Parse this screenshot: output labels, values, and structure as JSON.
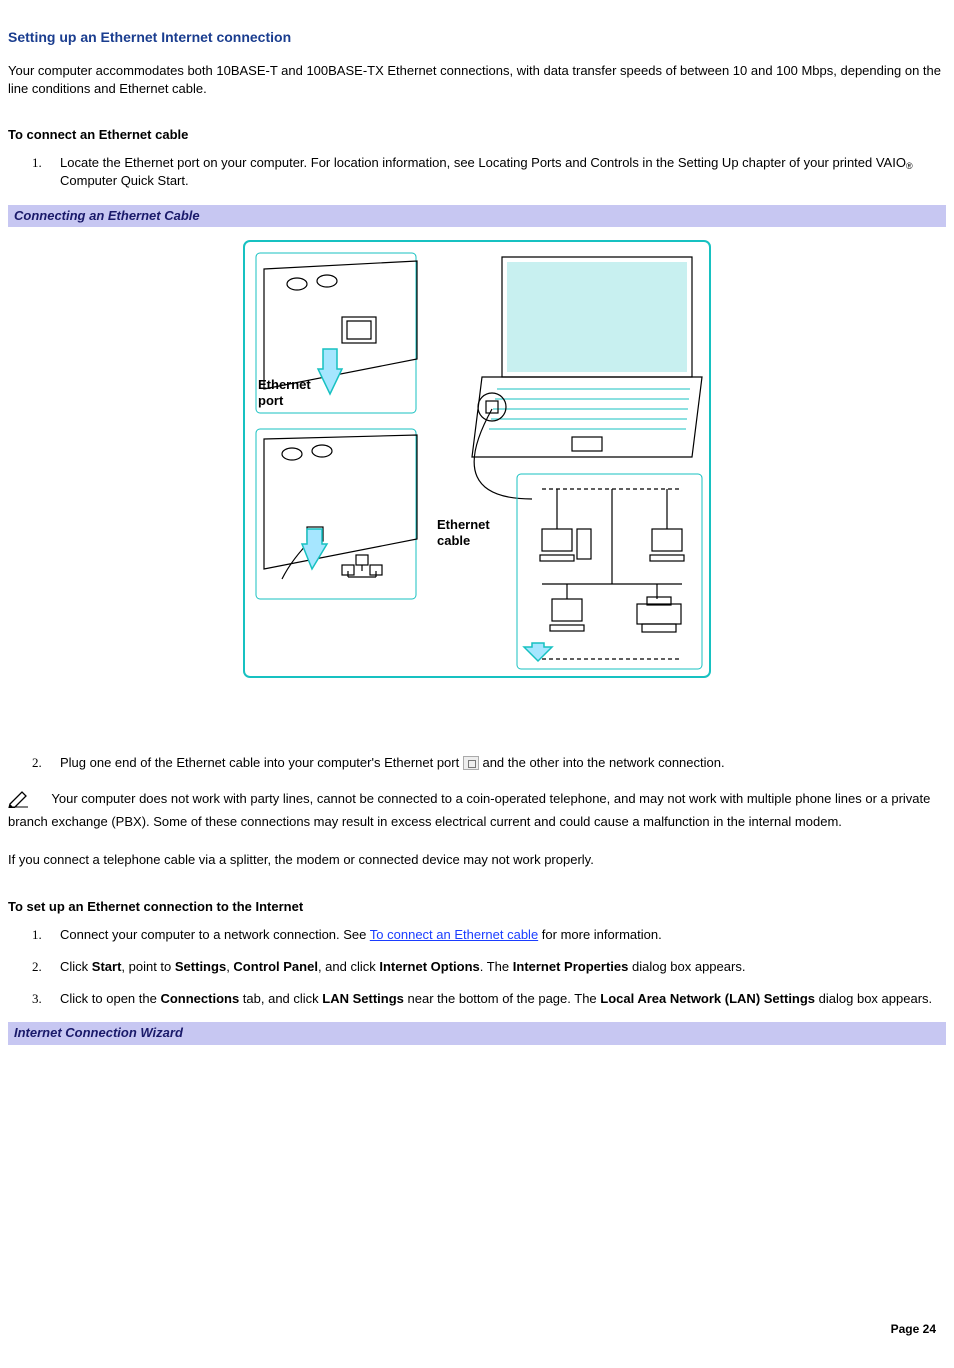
{
  "heading": "Setting up an Ethernet Internet connection",
  "intro": "Your computer accommodates both 10BASE-T and 100BASE-TX Ethernet connections, with data transfer speeds of between 10 and 100 Mbps, depending on the line conditions and Ethernet cable.",
  "sub1": "To connect an Ethernet cable",
  "step1a": "Locate the Ethernet port on your computer. For location information, see Locating Ports and Controls in the Setting Up chapter of your printed VAIO",
  "step1b": " Computer Quick Start.",
  "reg": "®",
  "caption1": "Connecting an Ethernet Cable",
  "fig_label_port": "Ethernet",
  "fig_label_port2": "port",
  "fig_label_cable": "Ethernet",
  "fig_label_cable2": "cable",
  "step2a": "Plug one end of the Ethernet cable into your computer's Ethernet port ",
  "step2b": " and the other into the network connection.",
  "note_p1": "Your computer does not work with party lines, cannot be connected to a coin-operated telephone, and may not work with multiple phone lines or a private branch exchange (PBX). Some of these connections may result in excess electrical current and could cause a malfunction in the internal modem.",
  "note_p2": "If you connect a telephone cable via a splitter, the modem or connected device may not work properly.",
  "sub2": "To set up an Ethernet connection to the Internet",
  "setup1a": "Connect your computer to a network connection. See ",
  "setup1_link": "To connect an Ethernet cable",
  "setup1b": " for more information.",
  "setup2_parts": {
    "a": "Click ",
    "b": "Start",
    "c": ", point to ",
    "d": "Settings",
    "e": ", ",
    "f": "Control Panel",
    "g": ", and click ",
    "h": "Internet Options",
    "i": ". The ",
    "j": "Internet Properties",
    "k": " dialog box appears."
  },
  "setup3_parts": {
    "a": "Click to open the ",
    "b": "Connections",
    "c": " tab, and click ",
    "d": "LAN Settings",
    "e": " near the bottom of the page. The ",
    "f": "Local Area Network (LAN) Settings",
    "g": " dialog box appears."
  },
  "caption2": "Internet Connection Wizard",
  "page_num": "Page 24"
}
